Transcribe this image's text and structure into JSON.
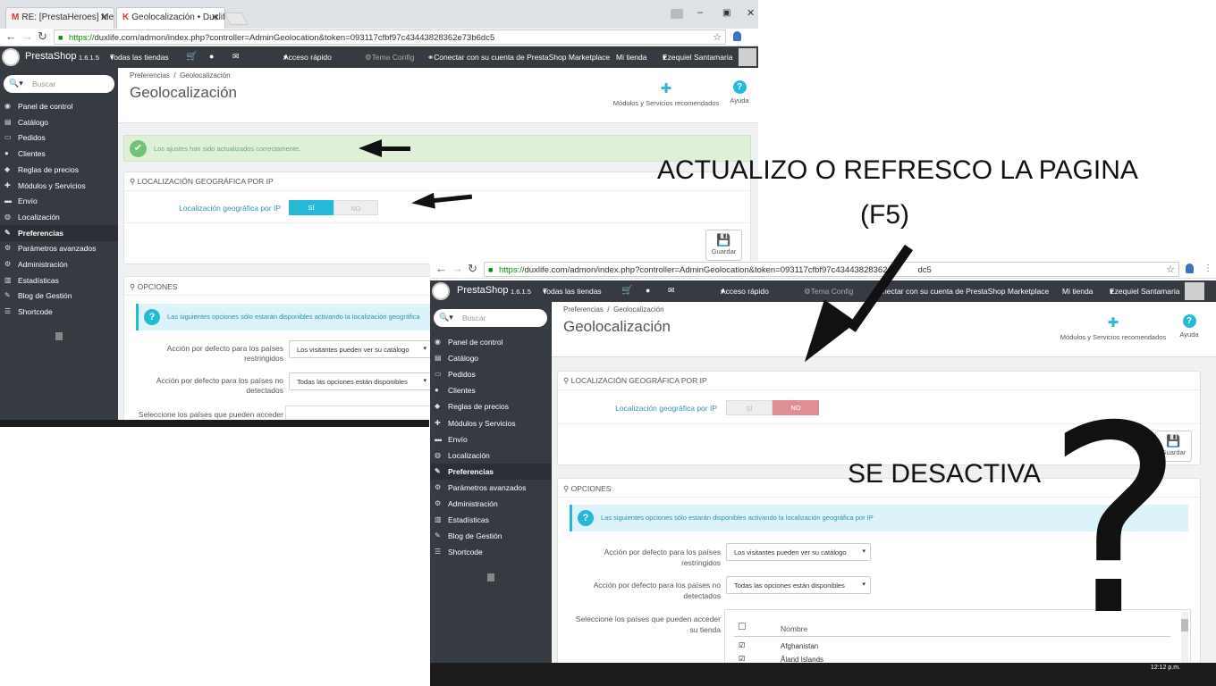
{
  "win1": {
    "tabs": [
      {
        "label": "RE: [PrestaHeroes] Mens",
        "icon": "gmail-icon"
      },
      {
        "label": "Geolocalización • Duxlife",
        "icon": "prestashop-icon"
      }
    ],
    "url_https": "https://",
    "url_rest": "duxlife.com/admon/index.php?controller=AdminGeolocation&token=093117cfbf97c43443828362e73b6dc5",
    "header": {
      "brand": "PrestaShop",
      "version": "1.6.1.5",
      "shops": "Todas las tiendas",
      "quick_access": "Acceso rápido",
      "theme": "Tema Config",
      "connect": "Conectar con su cuenta de PrestaShop Marketplace",
      "my_shop": "Mi tienda",
      "user": "Ezequiel Santamaria"
    },
    "search_placeholder": "Buscar",
    "menu": [
      "Panel de control",
      "Catálogo",
      "Pedidos",
      "Clientes",
      "Reglas de precios",
      "Módulos y Servicios",
      "Envío",
      "Localización",
      "Preferencias",
      "Parámetros avanzados",
      "Administración",
      "Estadísticas",
      "Blog de Gestión",
      "Shortcode"
    ],
    "breadcrumb": {
      "parent": "Preferencias",
      "sep": "/",
      "current": "Geolocalización"
    },
    "title": "Geolocalización",
    "toolbar": {
      "modules": "Módulos y Servicios recomendados",
      "help": "Ayuda"
    },
    "success": "Los ajustes han sido actualizados correctamente.",
    "geo_panel_title": "LOCALIZACIÓN GEOGRÁFICA POR IP",
    "geo_label": "Localización geográfica por IP",
    "yes": "SÍ",
    "no": "NO",
    "save": "Guardar",
    "options_title": "OPCIONES",
    "info": "Las siguientes opciones sólo estarán disponibles activando la localización geográfica",
    "opt1_label_a": "Acción por defecto para los países",
    "opt1_label_b": "restringidos",
    "opt1_value": "Los visitantes pueden ver su catálogo",
    "opt2_label_a": "Acción por defecto para los países no",
    "opt2_label_b": "detectados",
    "opt2_value": "Todas las opciones están disponibles",
    "opt3_label": "Seleccione los países que pueden acceder"
  },
  "win2": {
    "url_https": "https://",
    "url_rest": "duxlife.com/admon/index.php?controller=AdminGeolocation&token=093117cfbf97c43443828362",
    "url_tail": "dc5",
    "header": {
      "brand": "PrestaShop",
      "version": "1.6.1.5",
      "shops": "Todas las tiendas",
      "quick_access": "Acceso rápido",
      "theme": "Tema Config",
      "connect": "nectar con su cuenta de PrestaShop Marketplace",
      "my_shop": "Mi tienda",
      "user": "Ezequiel Santamaria"
    },
    "search_placeholder": "Buscar",
    "menu": [
      "Panel de control",
      "Catálogo",
      "Pedidos",
      "Clientes",
      "Reglas de precios",
      "Módulos y Servicios",
      "Envío",
      "Localización",
      "Preferencias",
      "Parámetros avanzados",
      "Administración",
      "Estadísticas",
      "Blog de Gestión",
      "Shortcode"
    ],
    "breadcrumb": {
      "parent": "Preferencias",
      "sep": "/",
      "current": "Geolocalización"
    },
    "title": "Geolocalización",
    "toolbar": {
      "modules": "Módulos y Servicios recomendados",
      "help": "Ayuda"
    },
    "geo_panel_title": "LOCALIZACIÓN GEOGRÁFICA POR IP",
    "geo_label": "Localización geográfica por IP",
    "yes": "SÍ",
    "no": "NO",
    "save": "Guardar",
    "options_title": "OPCIONES",
    "info": "Las siguientes opciones sólo estarán disponibles activando la localización geográfica por IP",
    "opt1_label_a": "Acción por defecto para los países",
    "opt1_label_b": "restringidos",
    "opt1_value": "Los visitantes pueden ver su catálogo",
    "opt2_label_a": "Acción por defecto para los países no",
    "opt2_label_b": "detectados",
    "opt2_value": "Todas las opciones están disponibles",
    "opt3_label_a": "Seleccione los países que pueden acceder",
    "opt3_label_b": "su tienda",
    "col_name": "Nombre",
    "countries": [
      "Afghanistan",
      "Åland Islands"
    ],
    "clock": "12:12 p.m."
  },
  "annotations": {
    "refresh": "ACTUALIZO O REFRESCO LA PAGINA",
    "f5": "(F5)",
    "deactivates": "SE DESACTIVA",
    "question": "?"
  },
  "colors": {
    "header_bg": "#363a41",
    "accent": "#25b9d7",
    "no_red": "#e08f95",
    "success_bg": "#dff0d8",
    "info_bg": "#dcf4f9"
  }
}
